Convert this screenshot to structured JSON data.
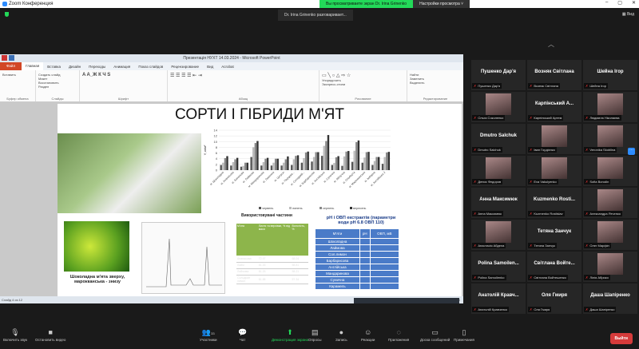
{
  "titlebar": {
    "app": "Zoom Конференция",
    "viewing": "Вы просматриваете экран Dr. Irina Grinenko",
    "view_options": "Настройки просмотра ˅",
    "min": "–",
    "max": "▢",
    "close": "✕"
  },
  "speaking": "Dr. Irina Grinenko разговаривает...",
  "view_label": "Вид",
  "ppt": {
    "title": "Презентація НУХТ 14.03.2024 - Microsoft PowerPoint",
    "tabs": [
      "Файл",
      "Главная",
      "Вставка",
      "Дизайн",
      "Переходы",
      "Анимация",
      "Показ слайдов",
      "Рецензирование",
      "Вид",
      "Acrobat"
    ],
    "groups": [
      "Буфер обмена",
      "Слайды",
      "Шрифт",
      "Абзац",
      "Рисование",
      "Редактирование"
    ],
    "buttons": [
      "Вставить",
      "Создать слайд",
      "Макет",
      "Восстановить",
      "Раздел",
      "Упорядочить",
      "Экспресс-стили",
      "Найти",
      "Заменить",
      "Выделить"
    ],
    "status": "Слайд 4 из 12",
    "zoom": "120%"
  },
  "slide": {
    "title": "СОРТИ І ГІБРИДИ М'ЯТ",
    "caption": "Шоколадна м'ята зверху, марокканська - знизу",
    "t1title": "Використовувані частини",
    "t1head": [
      "М'ята",
      "Листя та верхівки, % від маси",
      "Вологість, %"
    ],
    "t1rows": [
      [
        "Ананасова",
        "72.97",
        "68.04"
      ],
      [
        "Лайм",
        "81.33",
        "58.81"
      ],
      [
        "Лаймова",
        "81.33",
        "58.21"
      ],
      [
        "Солодкий лимон",
        "81.88",
        "57.34"
      ]
    ],
    "phtitle": "pH і ОВП екстрактів (параметри води pH 6.8 ОВП 110)",
    "t2head": [
      "М'яти",
      "pH",
      "ОВП, мВ"
    ],
    "t2rows": [
      "Шоколадна",
      "Лаймова",
      "Сол.лимон",
      "Барбарисова",
      "Англійська",
      "Мандаринова",
      "Сунична",
      "Карамель"
    ]
  },
  "chart_data": {
    "type": "bar",
    "ylabel": "Y, кг/м²",
    "ylim": [
      0,
      14
    ],
    "yticks": [
      0,
      2,
      4,
      6,
      8,
      10,
      12,
      14
    ],
    "categories": [
      "м. Шоколадна",
      "м. Ананасова",
      "м. Бананова",
      "м. Лаймова",
      "м. Мандаринова",
      "м. Лимонна",
      "м. Цитрон",
      "м. Перцева...",
      "м. Солодкий...",
      "м. Барбарисова",
      "м. Англійська",
      "м. Сунична",
      "м. Яблучна",
      "м. Ольберта",
      "м. Марокканська",
      "м. Імбирна",
      "м. Англійська 2"
    ],
    "series": [
      {
        "name": "червень",
        "color": "#555555",
        "values": [
          1.8,
          1.6,
          1.2,
          4.6,
          1.6,
          1.6,
          1.6,
          1.8,
          2.6,
          3.0,
          5.0,
          1.8,
          1.5,
          2.9,
          2.6,
          1.8,
          2.2
        ]
      },
      {
        "name": "липень",
        "color": "#bbbbbb",
        "values": [
          2.6,
          2.8,
          1.5,
          8.0,
          2.8,
          2.6,
          2.6,
          3.8,
          4.2,
          4.6,
          8.5,
          2.5,
          4.8,
          6.8,
          4.4,
          3.2,
          4.6
        ]
      },
      {
        "name": "серпень",
        "color": "#888888",
        "values": [
          4.2,
          3.8,
          2.6,
          9.5,
          4.0,
          4.0,
          3.8,
          5.0,
          6.2,
          6.3,
          10.2,
          4.5,
          6.5,
          9.8,
          6.3,
          4.6,
          6.2
        ]
      },
      {
        "name": "вересень",
        "color": "#333333",
        "values": [
          4.9,
          4.3,
          2.6,
          10.2,
          4.3,
          4.0,
          4.8,
          5.2,
          6.5,
          6.3,
          12.3,
          4.9,
          6.7,
          10.4,
          6.4,
          4.6,
          6.4
        ]
      }
    ]
  },
  "participants": [
    {
      "name": "Пушенко Дар'я",
      "label": "Пушенко Дар'я",
      "photo": false
    },
    {
      "name": "Возняк Світлана",
      "label": "Возняк Світлана",
      "photo": false
    },
    {
      "name": "Шейна Ігор",
      "label": "Шейна Ігор",
      "photo": false
    },
    {
      "name": "",
      "label": "Ольга Соколенко",
      "photo": true
    },
    {
      "name": "Карпінський А...",
      "label": "Карпінський Артем",
      "photo": false
    },
    {
      "name": "",
      "label": "Людмила Ніколаєва",
      "photo": true
    },
    {
      "name": "Dmutro Salchuk",
      "label": "Dmutro Salchuk",
      "photo": false
    },
    {
      "name": "",
      "label": "Іван Гордієнко",
      "photo": true
    },
    {
      "name": "",
      "label": "Veronika Skoblina",
      "photo": true
    },
    {
      "name": "",
      "label": "Денис Федоров",
      "photo": true
    },
    {
      "name": "",
      "label": "Eva Vakulyenko",
      "photo": true
    },
    {
      "name": "",
      "label": "Sofia Borodin",
      "photo": true
    },
    {
      "name": "Анна Максимюк",
      "label": "Анна Максимюк",
      "photo": false
    },
    {
      "name": "Kuzmenko Rosti...",
      "label": "Kuzmenko Rostislav",
      "photo": false
    },
    {
      "name": "",
      "label": "Александра Ятченко",
      "photo": true
    },
    {
      "name": "",
      "label": "Анастасія Абдела",
      "photo": true
    },
    {
      "name": "Тетяна Занчук",
      "label": "Тетяна Занчук",
      "photo": false
    },
    {
      "name": "",
      "label": "Олег Марфін",
      "photo": true
    },
    {
      "name": "Polina Samoilen...",
      "label": "Polina Samoilenko",
      "photo": false
    },
    {
      "name": "Світлана Войте...",
      "label": "Світлана Войтешенко",
      "photo": false
    },
    {
      "name": "",
      "label": "Лілія Абрико",
      "photo": true
    },
    {
      "name": "Анатолій Кравч...",
      "label": "Анатолій Кравченко",
      "photo": false
    },
    {
      "name": "Оля Гмиря",
      "label": "Оля Гмиря",
      "photo": false
    },
    {
      "name": "Даша Шапіренко",
      "label": "Даша Шапіренко",
      "photo": false
    }
  ],
  "toolbar": {
    "items": [
      {
        "label": "Включить звук",
        "icon": "🎙"
      },
      {
        "label": "Остановить видео",
        "icon": "■"
      },
      {
        "label": "Участники",
        "icon": "👥",
        "count": "33"
      },
      {
        "label": "Чат",
        "icon": "💬"
      },
      {
        "label": "Демонстрация экрана",
        "icon": "⬆"
      },
      {
        "label": "Опросы",
        "icon": "▤"
      },
      {
        "label": "Запись",
        "icon": "●"
      },
      {
        "label": "Реакции",
        "icon": "☺"
      },
      {
        "label": "Приложения",
        "icon": "◌"
      },
      {
        "label": "Доска сообщений",
        "icon": "▭"
      },
      {
        "label": "Примечания",
        "icon": "▯"
      }
    ],
    "leave": "Выйти"
  }
}
